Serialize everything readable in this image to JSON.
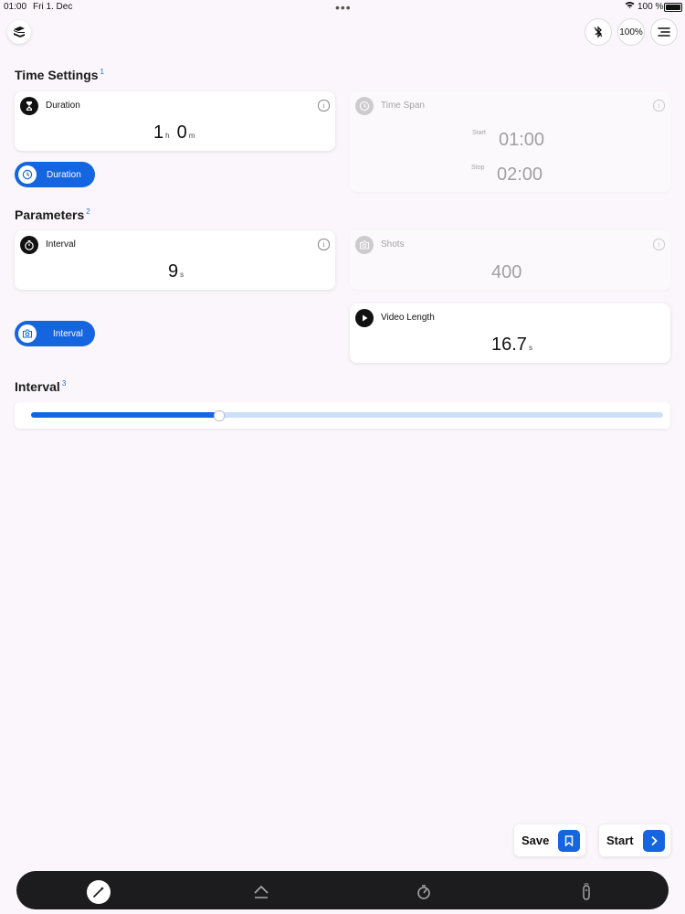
{
  "status_bar": {
    "time": "01:00",
    "date": "Fri 1. Dec",
    "battery": "100 %"
  },
  "header": {
    "battery_button": "100%"
  },
  "sections": {
    "time_settings": {
      "title": "Time Settings",
      "marker": "1"
    },
    "parameters": {
      "title": "Parameters",
      "marker": "2"
    },
    "interval": {
      "title": "Interval",
      "marker": "3"
    }
  },
  "duration_card": {
    "label": "Duration",
    "hours": "1",
    "hours_unit": "h",
    "minutes": "0",
    "minutes_unit": "m"
  },
  "time_span_card": {
    "label": "Time Span",
    "start_label": "Start",
    "start_value": "01:00",
    "stop_label": "Stop",
    "stop_value": "02:00"
  },
  "mode_toggle_duration": {
    "label": "Duration"
  },
  "interval_card": {
    "label": "Interval",
    "value": "9",
    "unit": "s"
  },
  "shots_card": {
    "label": "Shots",
    "value": "400"
  },
  "mode_toggle_interval": {
    "label": "Interval"
  },
  "video_length_card": {
    "label": "Video Length",
    "value": "16.7",
    "unit": "s"
  },
  "interval_slider": {
    "fill_fraction": 0.296
  },
  "actions": {
    "save": "Save",
    "start": "Start"
  },
  "info_glyph": "i",
  "colors": {
    "accent": "#1565e0",
    "track": "#cddff9",
    "background": "#fbf6fb",
    "tabbar": "#1c1c1e"
  },
  "icons": {
    "logo": "app-logo-icon",
    "bluetooth": "bluetooth-icon",
    "menu": "menu-icon",
    "duration": "hourglass-icon",
    "time_span": "clock-icon",
    "interval": "stopwatch-icon",
    "shots": "camera-icon",
    "video": "play-icon",
    "save": "bookmark-icon",
    "start": "chevron-right-icon",
    "tabs": [
      "wand-icon",
      "home-icon",
      "timer-icon",
      "remote-icon"
    ]
  }
}
